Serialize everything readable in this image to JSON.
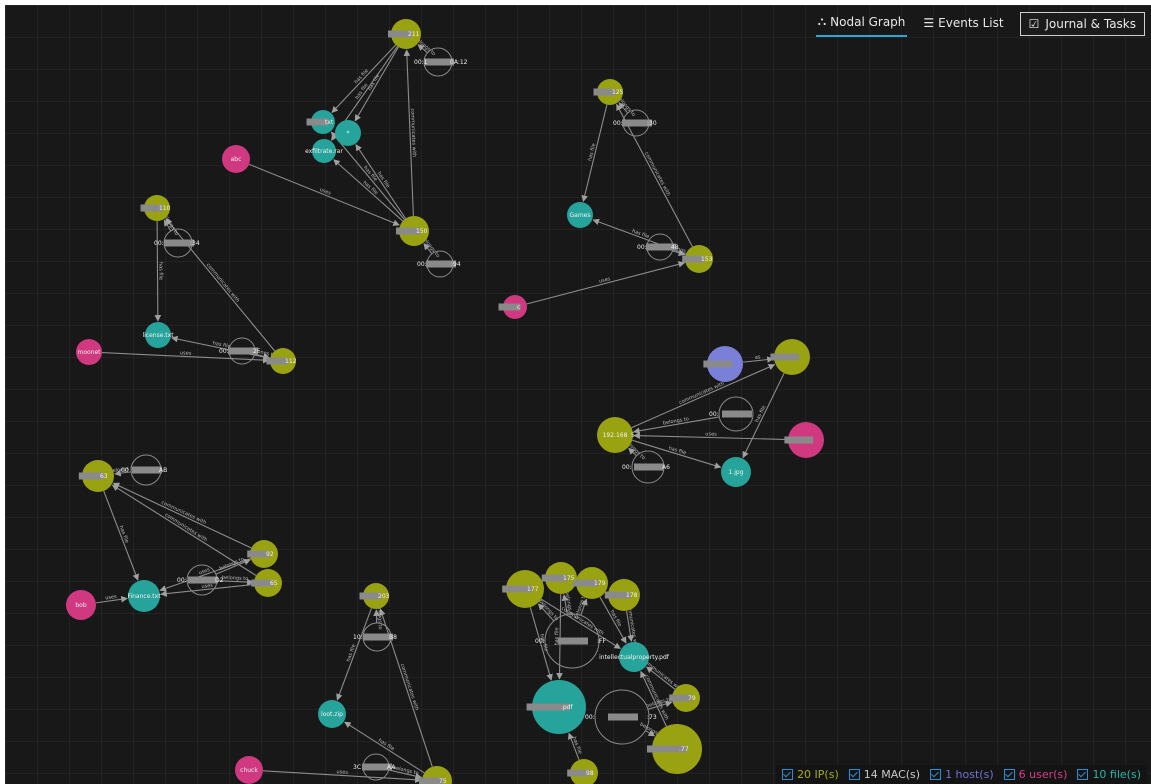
{
  "tabs": [
    {
      "label": "Nodal Graph",
      "icon": "graph-nodes-icon",
      "active": true
    },
    {
      "label": "Events List",
      "icon": "list-icon",
      "active": false
    }
  ],
  "journal_button": {
    "label": "Journal & Tasks",
    "icon": "checklist-icon"
  },
  "legend": [
    {
      "label": "20 IP(s)",
      "color": "#a8ad12"
    },
    {
      "label": "14 MAC(s)",
      "color": "#c9c9c9"
    },
    {
      "label": "1 host(s)",
      "color": "#6f72d3"
    },
    {
      "label": "6 user(s)",
      "color": "#d93d8a"
    },
    {
      "label": "10 file(s)",
      "color": "#29b6a8"
    }
  ],
  "colors": {
    "ip": "#99a211",
    "mac_stroke": "#8a8a8a",
    "host": "#7a7fd8",
    "user": "#d0387f",
    "file": "#26a39a",
    "edge": "#8c8c8c",
    "active_tab": "#27a9d6",
    "checkbox": "#2a8ed6"
  },
  "nodes": [
    {
      "type": "ip",
      "label": "211",
      "redacted": true
    },
    {
      "type": "mac",
      "label": "00:1",
      "label2": "0A:12",
      "redacted": true
    },
    {
      "type": "file",
      "label": "txt",
      "redacted": true
    },
    {
      "type": "file",
      "label": "*"
    },
    {
      "type": "file",
      "label": "exfiltrate.rar"
    },
    {
      "type": "user",
      "label": "abc"
    },
    {
      "type": "ip",
      "label": "150",
      "redacted": true
    },
    {
      "type": "mac",
      "label": "00:",
      "label2": ":94",
      "redacted": true
    },
    {
      "type": "ip",
      "label": "125",
      "redacted": true
    },
    {
      "type": "mac",
      "label": "00:",
      "label2": ":30",
      "redacted": true
    },
    {
      "type": "file",
      "label": "Games"
    },
    {
      "type": "mac",
      "label": "00:",
      "label2": "48",
      "redacted": true
    },
    {
      "type": "ip",
      "label": "153",
      "redacted": true
    },
    {
      "type": "user",
      "label": "c",
      "redacted": true
    },
    {
      "type": "ip",
      "label": "110",
      "redacted": true
    },
    {
      "type": "mac",
      "label": "00:",
      "label2": ":34",
      "redacted": true
    },
    {
      "type": "file",
      "label": "license.txt"
    },
    {
      "type": "mac",
      "label": "00:",
      "label2": "2F",
      "redacted": true
    },
    {
      "type": "ip",
      "label": "112",
      "redacted": true
    },
    {
      "type": "user",
      "label": "moonet"
    },
    {
      "type": "host",
      "label": "",
      "redacted": true
    },
    {
      "type": "ip",
      "label": "",
      "redacted": true
    },
    {
      "type": "mac",
      "label": "00:",
      "label2": "",
      "redacted": true
    },
    {
      "type": "ip",
      "label": "192.168",
      "label2": "5"
    },
    {
      "type": "user",
      "label": "",
      "redacted": true
    },
    {
      "type": "mac",
      "label": "00:",
      "label2": "A6",
      "redacted": true
    },
    {
      "type": "file",
      "label": "1.jpg"
    },
    {
      "type": "ip",
      "label": "63",
      "redacted": true
    },
    {
      "type": "mac",
      "label": "00",
      "label2": "AB",
      "redacted": true
    },
    {
      "type": "ip",
      "label": "92",
      "redacted": true
    },
    {
      "type": "ip",
      "label": "65",
      "redacted": true
    },
    {
      "type": "mac",
      "label": "00:",
      "label2": "D2",
      "redacted": true
    },
    {
      "type": "file",
      "label": "Finance.txt"
    },
    {
      "type": "user",
      "label": "bob"
    },
    {
      "type": "ip",
      "label": "203",
      "redacted": true
    },
    {
      "type": "mac",
      "label": "10:",
      "label2": "B8",
      "redacted": true
    },
    {
      "type": "file",
      "label": "loot.zip"
    },
    {
      "type": "mac",
      "label": "3C",
      "label2": "AA",
      "redacted": true
    },
    {
      "type": "ip",
      "label": "75",
      "redacted": true
    },
    {
      "type": "user",
      "label": "chuck"
    },
    {
      "type": "ip",
      "label": "177",
      "redacted": true
    },
    {
      "type": "ip",
      "label": "175",
      "redacted": true
    },
    {
      "type": "ip",
      "label": "179",
      "redacted": true
    },
    {
      "type": "ip",
      "label": "178",
      "redacted": true
    },
    {
      "type": "mac",
      "label": "00:",
      "label2": ":FF",
      "redacted": true
    },
    {
      "type": "file",
      "label": "intellectualproperty.pdf"
    },
    {
      "type": "file",
      "label": ".pdf",
      "redacted": true
    },
    {
      "type": "mac",
      "label": "00:",
      "label2": ":73",
      "redacted": true
    },
    {
      "type": "ip",
      "label": "79",
      "redacted": true
    },
    {
      "type": "ip",
      "label": ".77",
      "redacted": true
    },
    {
      "type": "ip",
      "label": "98",
      "redacted": true
    }
  ],
  "edges": [
    {
      "from": 6,
      "to": 0,
      "label": "communicates with"
    },
    {
      "from": 0,
      "to": 2,
      "label": "has file"
    },
    {
      "from": 0,
      "to": 3,
      "label": "has file"
    },
    {
      "from": 0,
      "to": 4,
      "label": "has file"
    },
    {
      "from": 6,
      "to": 2,
      "label": "has file"
    },
    {
      "from": 6,
      "to": 3,
      "label": "has file"
    },
    {
      "from": 6,
      "to": 4,
      "label": "has file"
    },
    {
      "from": 5,
      "to": 6,
      "label": "uses"
    },
    {
      "from": 1,
      "to": 0,
      "label": "belongs to"
    },
    {
      "from": 7,
      "to": 6,
      "label": "belongs to"
    },
    {
      "from": 8,
      "to": 10,
      "label": "has file"
    },
    {
      "from": 12,
      "to": 8,
      "label": "communicates with"
    },
    {
      "from": 12,
      "to": 10,
      "label": "has file"
    },
    {
      "from": 13,
      "to": 12,
      "label": "uses"
    },
    {
      "from": 9,
      "to": 8,
      "label": "belongs to"
    },
    {
      "from": 11,
      "to": 12,
      "label": "belongs to"
    },
    {
      "from": 14,
      "to": 16,
      "label": "has file"
    },
    {
      "from": 18,
      "to": 14,
      "label": "communicates with"
    },
    {
      "from": 18,
      "to": 16,
      "label": "has file"
    },
    {
      "from": 19,
      "to": 18,
      "label": "uses"
    },
    {
      "from": 15,
      "to": 14,
      "label": "belongs to"
    },
    {
      "from": 17,
      "to": 18,
      "label": "belongs to"
    },
    {
      "from": 23,
      "to": 21,
      "label": "communicates with"
    },
    {
      "from": 20,
      "to": 21,
      "label": "as"
    },
    {
      "from": 21,
      "to": 26,
      "label": "has file"
    },
    {
      "from": 23,
      "to": 26,
      "label": "has file"
    },
    {
      "from": 24,
      "to": 23,
      "label": "uses"
    },
    {
      "from": 22,
      "to": 23,
      "label": "belongs to"
    },
    {
      "from": 25,
      "to": 23,
      "label": "belongs to"
    },
    {
      "from": 29,
      "to": 27,
      "label": "communicates with"
    },
    {
      "from": 30,
      "to": 27,
      "label": "communicates with"
    },
    {
      "from": 27,
      "to": 32,
      "label": "has file"
    },
    {
      "from": 29,
      "to": 32,
      "label": "uses"
    },
    {
      "from": 30,
      "to": 32,
      "label": "uses"
    },
    {
      "from": 33,
      "to": 32,
      "label": "uses"
    },
    {
      "from": 31,
      "to": 29,
      "label": "belongs to"
    },
    {
      "from": 31,
      "to": 30,
      "label": "belongs to"
    },
    {
      "from": 28,
      "to": 27,
      "label": "belongs to"
    },
    {
      "from": 34,
      "to": 36,
      "label": "has file"
    },
    {
      "from": 38,
      "to": 34,
      "label": "communicates with"
    },
    {
      "from": 38,
      "to": 36,
      "label": "has file"
    },
    {
      "from": 39,
      "to": 38,
      "label": "uses"
    },
    {
      "from": 35,
      "to": 34,
      "label": "belongs to"
    },
    {
      "from": 37,
      "to": 38,
      "label": "belongs to"
    },
    {
      "from": 40,
      "to": 46,
      "label": "has file"
    },
    {
      "from": 41,
      "to": 46,
      "label": "has file"
    },
    {
      "from": 42,
      "to": 45,
      "label": "has file"
    },
    {
      "from": 43,
      "to": 45,
      "label": "communicates with"
    },
    {
      "from": 44,
      "to": 40,
      "label": "belongs to"
    },
    {
      "from": 44,
      "to": 41,
      "label": "belongs to"
    },
    {
      "from": 44,
      "to": 42,
      "label": "belongs to"
    },
    {
      "from": 47,
      "to": 48,
      "label": "belongs to"
    },
    {
      "from": 47,
      "to": 49,
      "label": "belongs to"
    },
    {
      "from": 48,
      "to": 45,
      "label": "communicates with"
    },
    {
      "from": 49,
      "to": 45,
      "label": "communicates with"
    },
    {
      "from": 50,
      "to": 46,
      "label": "has file"
    },
    {
      "from": 40,
      "to": 45,
      "label": "communicates with"
    }
  ]
}
